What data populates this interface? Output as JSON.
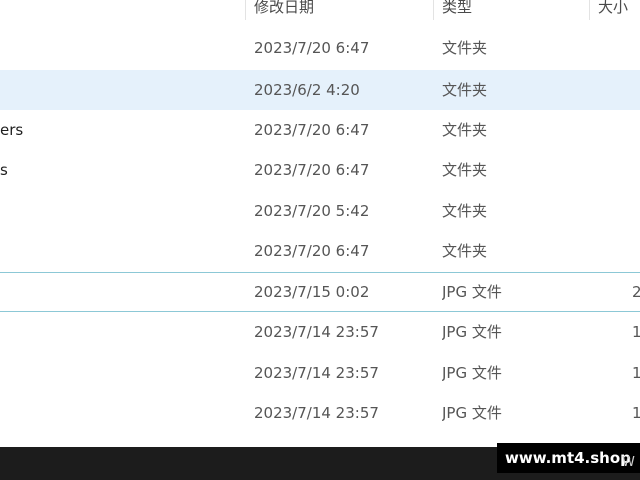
{
  "columns": {
    "date": "修改日期",
    "type": "类型",
    "size": "大小"
  },
  "rows": [
    {
      "name": "",
      "date": "2023/7/20 6:47",
      "type": "文件夹",
      "size": ""
    },
    {
      "name": "",
      "date": "2023/6/2 4:20",
      "type": "文件夹",
      "size": ""
    },
    {
      "name": "ers",
      "date": "2023/7/20 6:47",
      "type": "文件夹",
      "size": ""
    },
    {
      "name": "s",
      "date": "2023/7/20 6:47",
      "type": "文件夹",
      "size": ""
    },
    {
      "name": "",
      "date": "2023/7/20 5:42",
      "type": "文件夹",
      "size": ""
    },
    {
      "name": "",
      "date": "2023/7/20 6:47",
      "type": "文件夹",
      "size": ""
    },
    {
      "name": "",
      "date": "2023/7/15 0:02",
      "type": "JPG 文件",
      "size": "2"
    },
    {
      "name": "",
      "date": "2023/7/14 23:57",
      "type": "JPG 文件",
      "size": "1"
    },
    {
      "name": "",
      "date": "2023/7/14 23:57",
      "type": "JPG 文件",
      "size": "1"
    },
    {
      "name": "",
      "date": "2023/7/14 23:57",
      "type": "JPG 文件",
      "size": "1"
    }
  ],
  "watermark": {
    "text": "www.mt4.shop",
    "tail": "W"
  },
  "colors": {
    "selected_row": "#e5f1fb",
    "focus_border": "#8cc8d6",
    "taskbar": "#1c1c1c"
  }
}
